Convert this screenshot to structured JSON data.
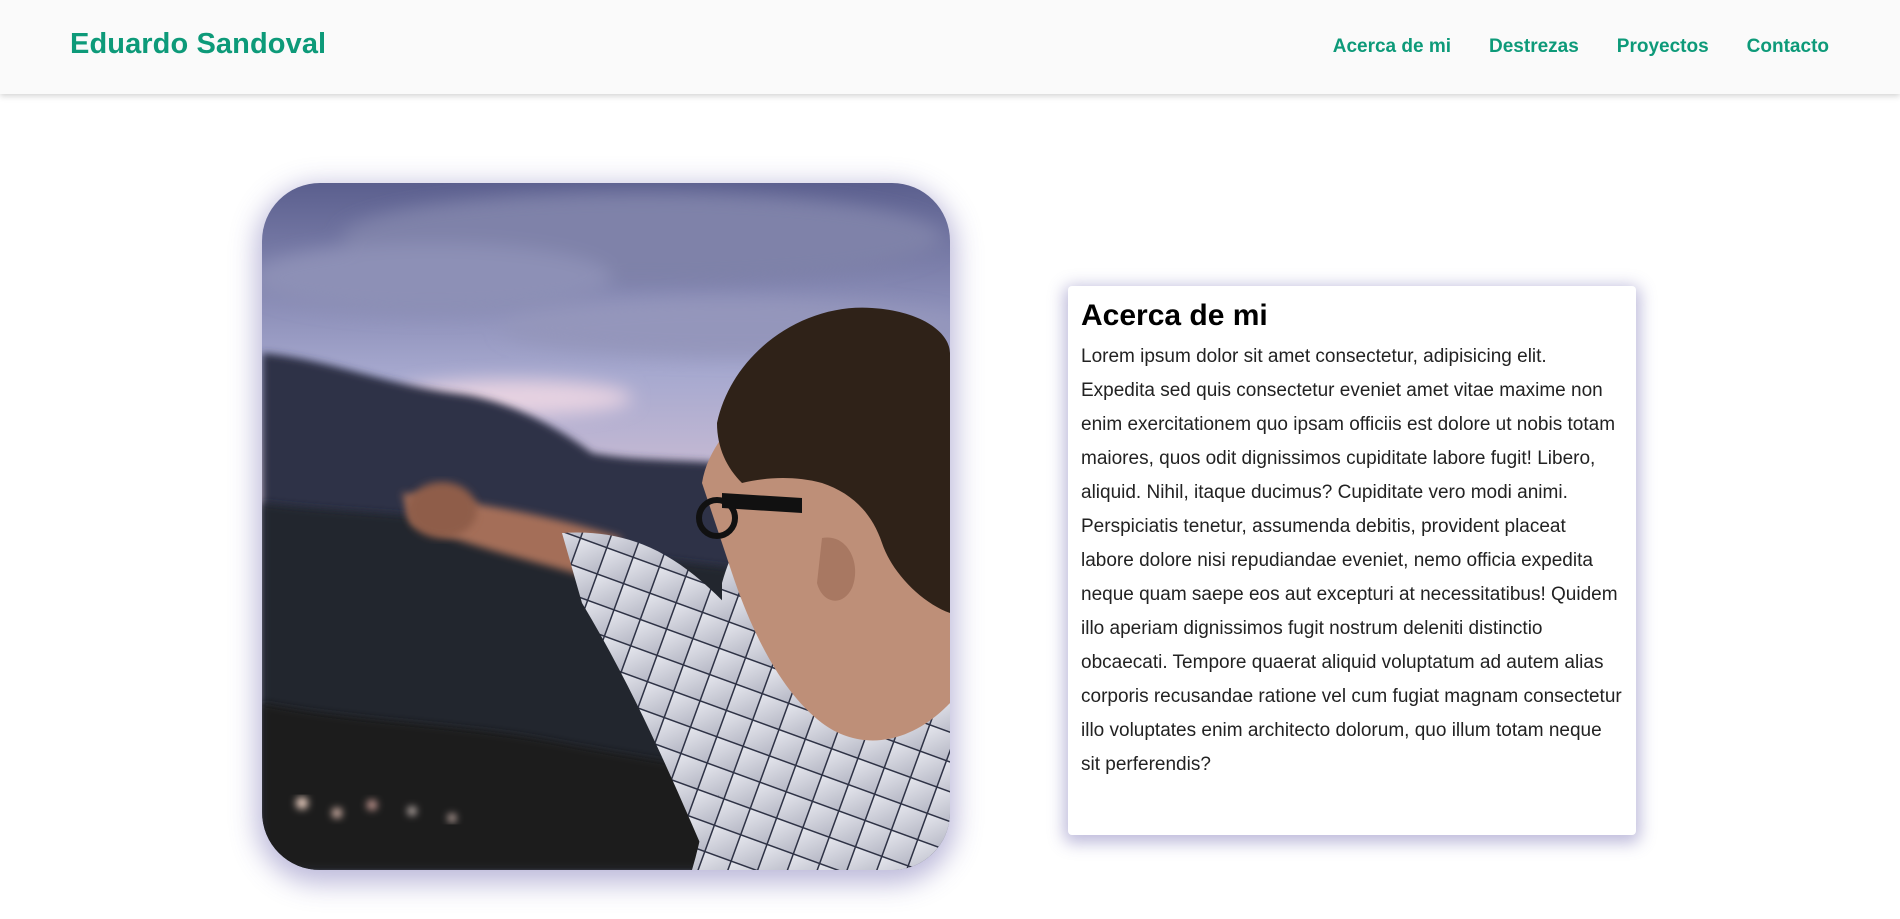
{
  "header": {
    "brand": "Eduardo Sandoval",
    "nav": [
      {
        "label": "Acerca de mi"
      },
      {
        "label": "Destrezas"
      },
      {
        "label": "Proyectos"
      },
      {
        "label": "Contacto"
      }
    ]
  },
  "about": {
    "title": "Acerca de mi",
    "body": "Lorem ipsum dolor sit amet consectetur, adipisicing elit. Expedita sed quis consectetur eveniet amet vitae maxime non enim exercitationem quo ipsam officiis est dolore ut nobis totam maiores, quos odit dignissimos cupiditate labore fugit! Libero, aliquid. Nihil, itaque ducimus? Cupiditate vero modi animi. Perspiciatis tenetur, assumenda debitis, provident placeat labore dolore nisi repudiandae eveniet, nemo officia expedita neque quam saepe eos aut excepturi at necessitatibus! Quidem illo aperiam dignissimos fugit nostrum deleniti distinctio obcaecati. Tempore quaerat aliquid voluptatum ad autem alias corporis recusandae ratione vel cum fugiat magnam consectetur illo voluptates enim architecto dolorum, quo illum totam neque sit perferendis?"
  },
  "colors": {
    "accent": "#0d9a79",
    "header_bg": "#fafafa",
    "shadow": "#6e69af"
  }
}
